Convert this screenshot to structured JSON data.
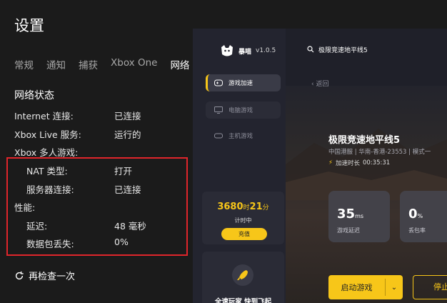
{
  "xbox": {
    "title": "设置",
    "tabs": [
      "常规",
      "通知",
      "捕获",
      "Xbox One",
      "网络"
    ],
    "active_tab": 4,
    "network_status_heading": "网络状态",
    "internet_label": "Internet 连接:",
    "internet_value": "已连接",
    "xbl_label": "Xbox Live 服务:",
    "xbl_value": "运行的",
    "multiplayer_label": "Xbox 多人游戏:",
    "nat_label": "NAT 类型:",
    "nat_value": "打开",
    "server_label": "服务器连接:",
    "server_value": "已连接",
    "performance_heading": "性能:",
    "latency_label": "延迟:",
    "latency_value": "48 毫秒",
    "packet_loss_label": "数据包丢失:",
    "packet_loss_value": "0%",
    "recheck_label": "再检查一次"
  },
  "booster": {
    "brand_name": "暴喵",
    "version": "v1.0.5",
    "nav": [
      "游戏加速",
      "电脑游戏",
      "主机游戏"
    ],
    "active_nav": 0,
    "time_hours": "3680",
    "time_hours_unit": "时",
    "time_minutes": "21",
    "time_minutes_unit": "分",
    "time_label": "计时中",
    "recharge_label": "充值",
    "promo_text": "全速玩家  快到飞起",
    "search_text": "极限竞速地平线5",
    "back_label": "返回",
    "game_title": "极限竞速地平线5",
    "game_sub": "中国港服 | 华南-香港-23553 | 模式一",
    "accel_label": "加速时长",
    "accel_value": "00:35:31",
    "latency_num": "35",
    "latency_unit": "ms",
    "latency_label": "游戏延迟",
    "loss_num": "0",
    "loss_unit": "%",
    "loss_label": "丢包率",
    "start_label": "启动游戏",
    "stop_label": "停止",
    "accent_color": "#f7c619"
  }
}
